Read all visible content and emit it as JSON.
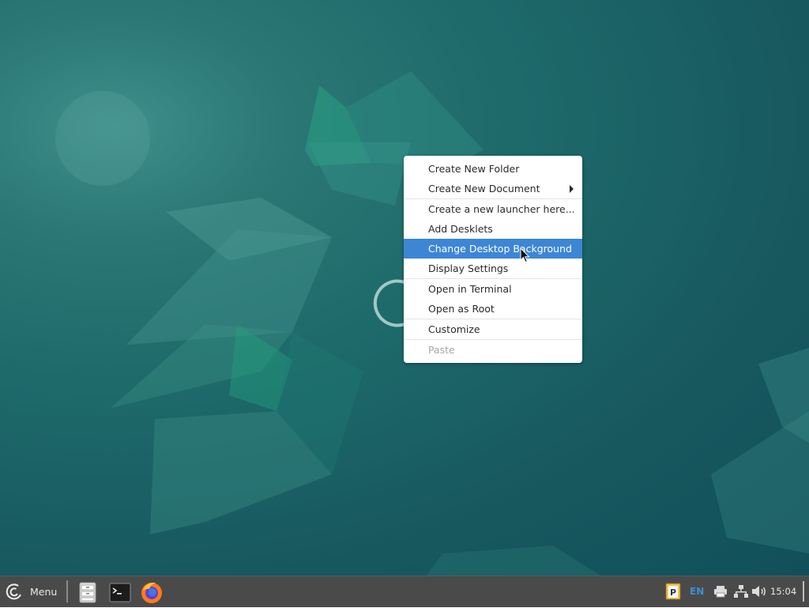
{
  "desktop": {
    "context_menu": {
      "items": [
        {
          "label": "Create New Folder"
        },
        {
          "label": "Create New Document",
          "has_submenu": true
        },
        {
          "label": "Create a new launcher here..."
        },
        {
          "label": "Add Desklets"
        },
        {
          "label": "Change Desktop Background",
          "highlighted": true
        },
        {
          "label": "Display Settings"
        },
        {
          "label": "Open in Terminal"
        },
        {
          "label": "Open as Root"
        },
        {
          "label": "Customize"
        },
        {
          "label": "Paste",
          "disabled": true
        }
      ]
    }
  },
  "panel": {
    "menu_label": "Menu",
    "launchers": [
      {
        "icon": "file-manager-icon"
      },
      {
        "icon": "terminal-icon"
      },
      {
        "icon": "firefox-icon"
      }
    ],
    "tray": {
      "keyboard_layout": "EN",
      "clock": "15:04"
    }
  },
  "colors": {
    "highlight": "#3d86d6",
    "panel": "#4a4a4a",
    "desktop": "#1e6a6b"
  }
}
